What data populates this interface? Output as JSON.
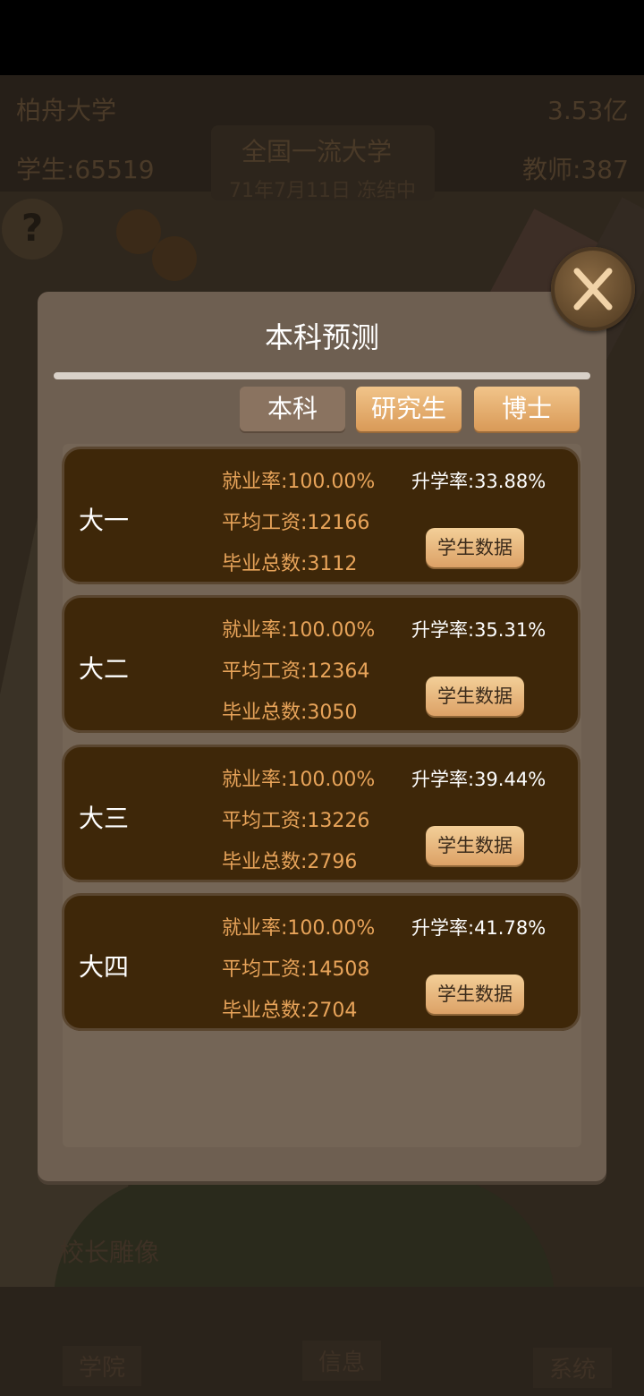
{
  "hud": {
    "university_name": "柏舟大学",
    "funds": "3.53亿",
    "rank_title": "全国一流大学",
    "students": "学生:65519",
    "teachers": "教师:387",
    "date_status": "71年7月11日 冻结中",
    "help_icon": "?"
  },
  "scene": {
    "statue_label": "校长雕像"
  },
  "bottom_nav": {
    "college": "学院",
    "info": "信息",
    "system": "系统"
  },
  "modal": {
    "title": "本科预测",
    "tabs": [
      "本科",
      "研究生",
      "博士"
    ],
    "cards": [
      {
        "year": "大一",
        "employment": "就业率:100.00%",
        "salary": "平均工资:12166",
        "graduates": "毕业总数:3112",
        "further_study": "升学率:33.88%",
        "button": "学生数据"
      },
      {
        "year": "大二",
        "employment": "就业率:100.00%",
        "salary": "平均工资:12364",
        "graduates": "毕业总数:3050",
        "further_study": "升学率:35.31%",
        "button": "学生数据"
      },
      {
        "year": "大三",
        "employment": "就业率:100.00%",
        "salary": "平均工资:13226",
        "graduates": "毕业总数:2796",
        "further_study": "升学率:39.44%",
        "button": "学生数据"
      },
      {
        "year": "大四",
        "employment": "就业率:100.00%",
        "salary": "平均工资:14508",
        "graduates": "毕业总数:2704",
        "further_study": "升学率:41.78%",
        "button": "学生数据"
      }
    ]
  },
  "colors": {
    "card_bg": "#3e2709",
    "accent_orange": "#e8a45a",
    "modal_bg": "#6e5f51",
    "button_gold": "#dca166"
  }
}
